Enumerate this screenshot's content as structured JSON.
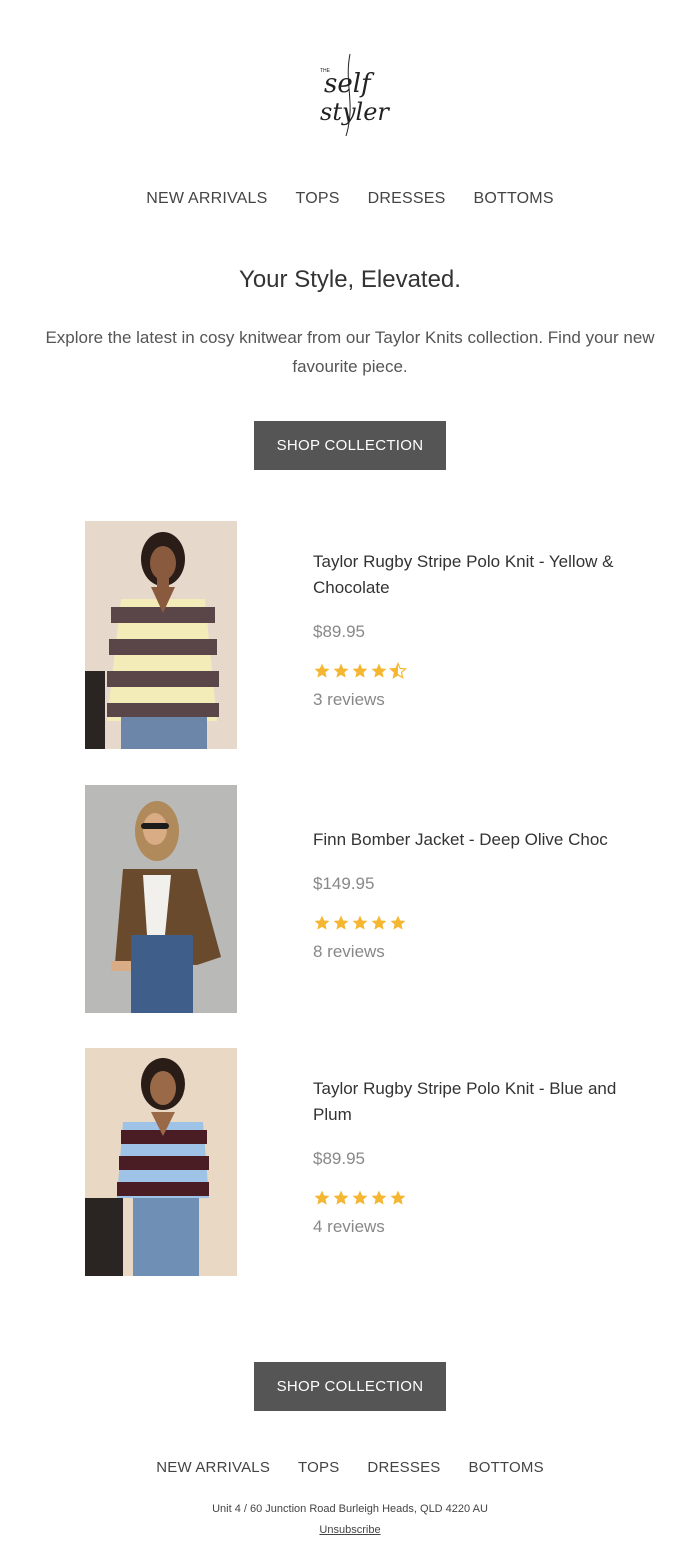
{
  "brand": {
    "logo_small": "THE",
    "logo_line1": "self",
    "logo_line2": "styler"
  },
  "nav": [
    "NEW ARRIVALS",
    "TOPS",
    "DRESSES",
    "BOTTOMS"
  ],
  "hero": {
    "headline": "Your Style, Elevated.",
    "intro": "Explore the latest in cosy knitwear from our Taylor Knits collection. Find your new favourite piece.",
    "cta": "SHOP COLLECTION"
  },
  "products": [
    {
      "name": "Taylor Rugby Stripe Polo Knit - Yellow & Chocolate",
      "price": "$89.95",
      "rating": 4.5,
      "reviews": "3 reviews",
      "image": "model in yellow and chocolate striped polo knit",
      "colors": {
        "bg": "#e6d9cc",
        "stripe_a": "#5a4648",
        "stripe_b": "#f3ecb8",
        "denim": "#6b86a8"
      }
    },
    {
      "name": "Finn Bomber Jacket - Deep Olive Choc",
      "price": "$149.95",
      "rating": 5,
      "reviews": "8 reviews",
      "image": "model in deep olive choc bomber jacket",
      "colors": {
        "bg": "#b9b9b7",
        "jacket": "#6a4a2c",
        "denim": "#3f5f8a"
      }
    },
    {
      "name": "Taylor Rugby Stripe Polo Knit - Blue and Plum",
      "price": "$89.95",
      "rating": 5,
      "reviews": "4 reviews",
      "image": "model in blue and plum striped polo knit",
      "colors": {
        "bg": "#e9d8c4",
        "stripe_a": "#4a1d24",
        "stripe_b": "#9fc3e6",
        "denim": "#6f8fb5"
      }
    }
  ],
  "footer": {
    "cta": "SHOP COLLECTION",
    "nav": [
      "NEW ARRIVALS",
      "TOPS",
      "DRESSES",
      "BOTTOMS"
    ],
    "address": "Unit 4 / 60 Junction Road Burleigh Heads, QLD 4220 AU",
    "unsubscribe": "Unsubscribe"
  },
  "theme": {
    "button_bg": "#555555",
    "star": "#f5b731",
    "text": "#333333",
    "muted": "#888888"
  }
}
